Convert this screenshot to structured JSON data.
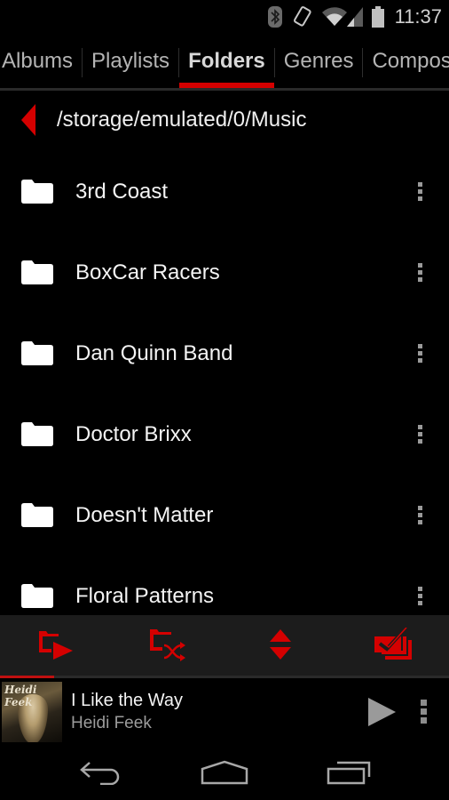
{
  "status_bar": {
    "time": "11:37",
    "icons": [
      "bluetooth-icon",
      "screen-rotation-icon",
      "wifi-icon",
      "cell-signal-icon",
      "battery-icon"
    ]
  },
  "tabs": [
    {
      "label": "Albums",
      "active": false
    },
    {
      "label": "Playlists",
      "active": false
    },
    {
      "label": "Folders",
      "active": true
    },
    {
      "label": "Genres",
      "active": false
    },
    {
      "label": "Composers",
      "active": false
    }
  ],
  "path": {
    "current": "/storage/emulated/0/Music",
    "back_icon": "triangle-left-icon"
  },
  "folders": [
    {
      "name": "3rd Coast"
    },
    {
      "name": "BoxCar Racers"
    },
    {
      "name": "Dan Quinn Band"
    },
    {
      "name": "Doctor Brixx"
    },
    {
      "name": "Doesn't Matter"
    },
    {
      "name": "Floral Patterns"
    }
  ],
  "action_bar": {
    "buttons": [
      {
        "name": "play-folder",
        "icon": "folder-play-icon"
      },
      {
        "name": "shuffle-folder",
        "icon": "folder-shuffle-icon"
      },
      {
        "name": "sort",
        "icon": "sort-up-down-icon"
      },
      {
        "name": "multi-select",
        "icon": "multi-select-check-icon"
      }
    ]
  },
  "now_playing": {
    "title": "I Like the Way",
    "artist": "Heidi Feek",
    "album_art_text": "Heidi Feek",
    "progress_percent": 12,
    "state": "paused"
  },
  "colors": {
    "accent": "#d40000",
    "background": "#000000",
    "action_bar_bg": "#1c1c1c"
  }
}
